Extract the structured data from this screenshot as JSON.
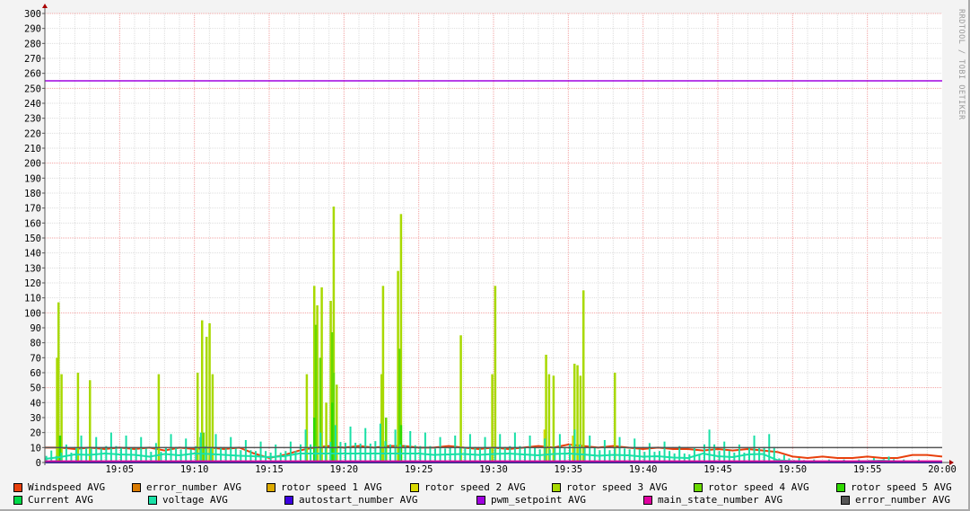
{
  "chart_data": {
    "type": "line",
    "title": "",
    "xlabel": "",
    "ylabel": "",
    "ylim": [
      0,
      300
    ],
    "yticks": [
      "0",
      "10",
      "20",
      "30",
      "40",
      "50",
      "60",
      "70",
      "80",
      "90",
      "100",
      "110",
      "120",
      "130",
      "140",
      "150",
      "160",
      "170",
      "180",
      "190",
      "200",
      "210",
      "220",
      "230",
      "240",
      "250",
      "260",
      "270",
      "280",
      "290",
      "300"
    ],
    "x_range_minutes_after_19_00": [
      0,
      60
    ],
    "xticks": [
      {
        "m": 5,
        "label": "19:05"
      },
      {
        "m": 10,
        "label": "19:10"
      },
      {
        "m": 15,
        "label": "19:15"
      },
      {
        "m": 20,
        "label": "19:20"
      },
      {
        "m": 25,
        "label": "19:25"
      },
      {
        "m": 30,
        "label": "19:30"
      },
      {
        "m": 35,
        "label": "19:35"
      },
      {
        "m": 40,
        "label": "19:40"
      },
      {
        "m": 45,
        "label": "19:45"
      },
      {
        "m": 50,
        "label": "19:50"
      },
      {
        "m": 55,
        "label": "19:55"
      },
      {
        "m": 60,
        "label": "20:00"
      }
    ],
    "grid": true,
    "watermark": "RRDTOOL / TOBI OETIKER",
    "series": [
      {
        "name": "Windspeed AVG",
        "color": "#e8400c",
        "kind": "line",
        "values": [
          10,
          10,
          9,
          10,
          9,
          10,
          9,
          10,
          8,
          10,
          9,
          10,
          9,
          10,
          6,
          3,
          5,
          8,
          10,
          11,
          10,
          11,
          10,
          11,
          11,
          10,
          10,
          11,
          10,
          9,
          10,
          9,
          10,
          11,
          10,
          12,
          11,
          10,
          11,
          10,
          9,
          10,
          9,
          9,
          8,
          9,
          8,
          9,
          8,
          7,
          4,
          3,
          4,
          3,
          3,
          4,
          3,
          3,
          5,
          5,
          4
        ]
      },
      {
        "name": "error_number AVG",
        "color": "#d97a00",
        "kind": "none",
        "values": []
      },
      {
        "name": "rotor speed 1 AVG",
        "color": "#dcaa00",
        "kind": "none",
        "values": []
      },
      {
        "name": "rotor speed 2 AVG",
        "color": "#d9d900",
        "kind": "spikes",
        "points": [
          [
            19.3,
            20
          ],
          [
            33.4,
            22
          ],
          [
            35.3,
            18
          ]
        ]
      },
      {
        "name": "rotor speed 3 AVG",
        "color": "#a8d900",
        "kind": "spikes",
        "points": [
          [
            0.8,
            70
          ],
          [
            0.9,
            107
          ],
          [
            1.1,
            59
          ],
          [
            2.2,
            60
          ],
          [
            3.0,
            55
          ],
          [
            7.6,
            59
          ],
          [
            10.2,
            60
          ],
          [
            10.5,
            95
          ],
          [
            10.8,
            84
          ],
          [
            11.0,
            93
          ],
          [
            11.2,
            59
          ],
          [
            17.5,
            59
          ],
          [
            18.0,
            118
          ],
          [
            18.2,
            105
          ],
          [
            18.5,
            117
          ],
          [
            18.8,
            40
          ],
          [
            19.1,
            108
          ],
          [
            19.3,
            171
          ],
          [
            19.5,
            52
          ],
          [
            22.5,
            59
          ],
          [
            22.6,
            118
          ],
          [
            23.6,
            128
          ],
          [
            23.8,
            166
          ],
          [
            27.8,
            85
          ],
          [
            29.9,
            59
          ],
          [
            30.1,
            118
          ],
          [
            33.5,
            72
          ],
          [
            33.7,
            59
          ],
          [
            34.0,
            58
          ],
          [
            35.4,
            66
          ],
          [
            35.6,
            65
          ],
          [
            35.8,
            58
          ],
          [
            36.0,
            115
          ],
          [
            38.1,
            60
          ]
        ]
      },
      {
        "name": "rotor speed 4 AVG",
        "color": "#6ad900",
        "kind": "spikes",
        "points": [
          [
            18.1,
            92
          ],
          [
            18.4,
            70
          ],
          [
            19.2,
            87
          ],
          [
            19.3,
            60
          ],
          [
            23.7,
            76
          ],
          [
            10.6,
            20
          ],
          [
            22.8,
            30
          ]
        ]
      },
      {
        "name": "rotor speed 5 AVG",
        "color": "#2fd900",
        "kind": "spikes",
        "points": [
          [
            1.0,
            18
          ],
          [
            10.4,
            17
          ],
          [
            18.0,
            30
          ],
          [
            19.2,
            40
          ],
          [
            23.8,
            25
          ]
        ]
      },
      {
        "name": "Current AVG",
        "color": "#00d94a",
        "kind": "none",
        "values": []
      },
      {
        "name": "voltage AVG",
        "color": "#19e0a6",
        "kind": "line",
        "values": [
          8,
          12,
          18,
          17,
          20,
          18,
          17,
          13,
          19,
          16,
          20,
          19,
          17,
          15,
          14,
          12,
          14,
          22,
          20,
          25,
          24,
          23,
          26,
          22,
          21,
          20,
          17,
          18,
          19,
          17,
          19,
          20,
          18,
          16,
          19,
          22,
          18,
          15,
          17,
          16,
          13,
          14,
          11,
          10,
          22,
          14,
          12,
          18,
          19,
          5,
          3,
          2,
          2,
          2,
          2,
          3,
          4,
          2,
          2,
          1,
          1
        ]
      },
      {
        "name": "autostart_number AVG",
        "color": "#3c00e0",
        "kind": "const",
        "value": 0
      },
      {
        "name": "pwm_setpoint AVG",
        "color": "#a000e0",
        "kind": "const",
        "value": 255
      },
      {
        "name": "main_state_number AVG",
        "color": "#e000a0",
        "kind": "const",
        "value": 1
      },
      {
        "name": "error_number AVG",
        "color": "#555555",
        "kind": "const",
        "value": 10
      }
    ]
  }
}
